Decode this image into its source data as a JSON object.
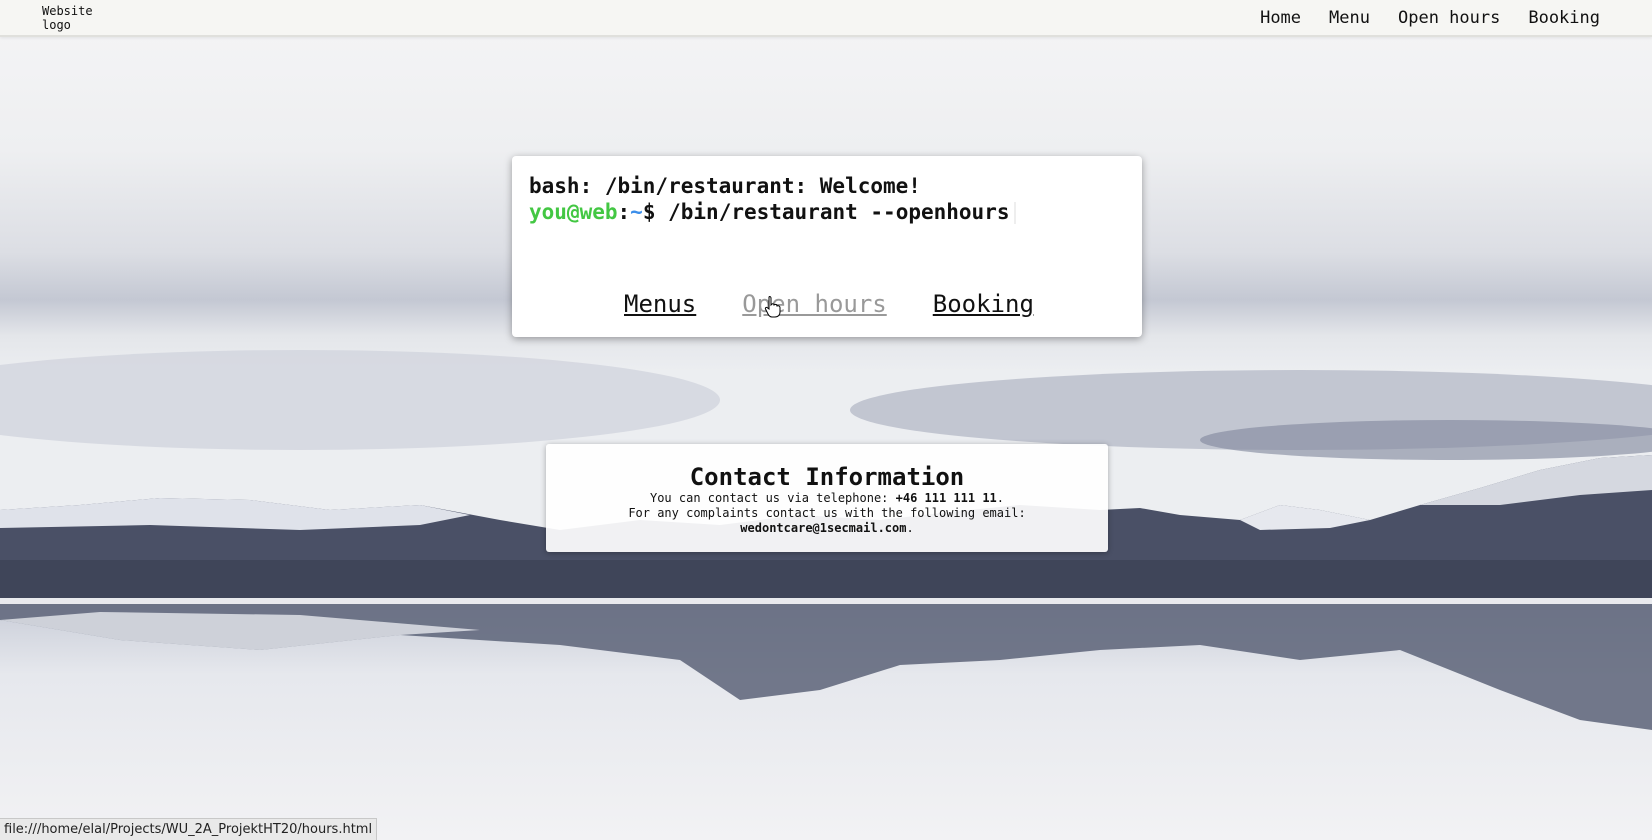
{
  "header": {
    "logo_text": "Website logo",
    "nav": [
      "Home",
      "Menu",
      "Open hours",
      "Booking"
    ]
  },
  "terminal": {
    "line1": "bash: /bin/restaurant: Welcome!",
    "prompt_user": "you@web",
    "prompt_colon": ":",
    "prompt_path": "~",
    "prompt_symbol": "$",
    "command": " /bin/restaurant --openhours",
    "links": [
      "Menus",
      "Open hours",
      "Booking"
    ]
  },
  "contact": {
    "title": "Contact Information",
    "line1_prefix": "You can contact us via telephone: ",
    "phone": "+46 111 111 11",
    "line1_suffix": ".",
    "line2": "For any complaints contact us with the following email:",
    "email": "wedontcare@1secmail.com",
    "line3_suffix": "."
  },
  "statusbar": {
    "url": "file:///home/elal/Projects/WU_2A_ProjektHT20/hours.html"
  },
  "colors": {
    "prompt_user": "#43c743",
    "prompt_path": "#3b8eea",
    "link_hover": "#999999"
  }
}
